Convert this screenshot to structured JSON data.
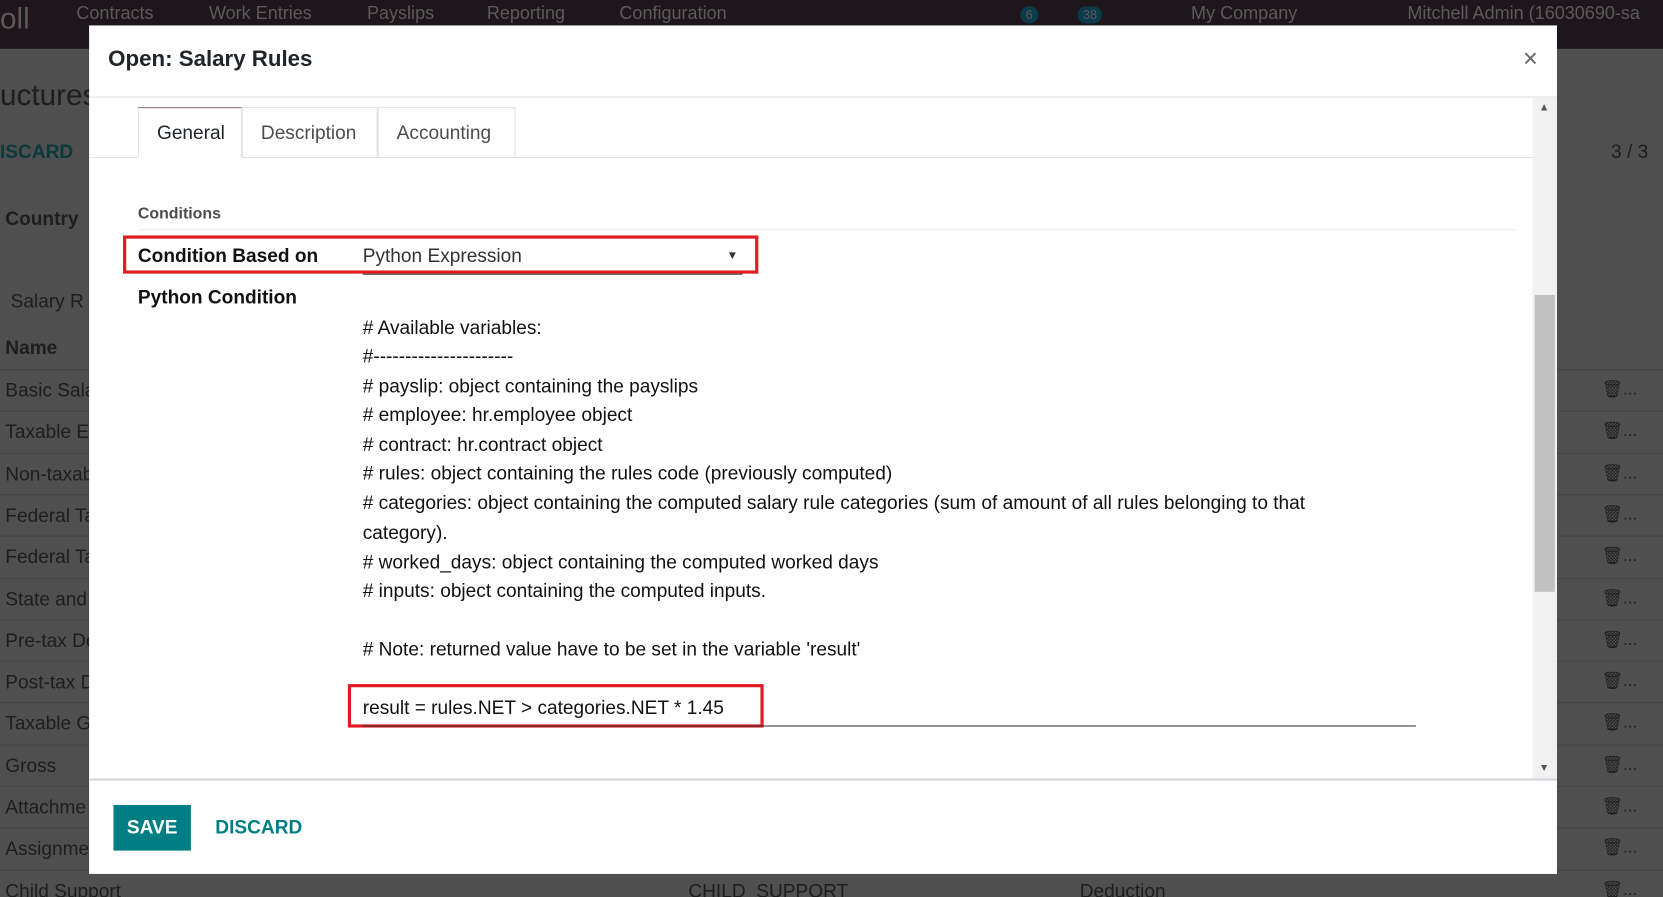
{
  "background": {
    "navbar": {
      "app": "oll",
      "menu": [
        "Contracts",
        "Work Entries",
        "Payslips",
        "Reporting",
        "Configuration"
      ],
      "badges": [
        "6",
        "38"
      ],
      "company": "My Company",
      "user": "Mitchell Admin (16030690-sa"
    },
    "breadcrumb": "uctures",
    "discard": "ISCARD",
    "pager": "3 / 3",
    "country_label": "Country",
    "tab": "Salary R",
    "column_name": "Name",
    "rows": [
      "Basic Sala",
      "Taxable E",
      "Non-taxab",
      "Federal Ta",
      "Federal Ta",
      "State and",
      "Pre-tax De",
      "Post-tax D",
      "Taxable G",
      "Gross",
      "Attachme",
      "Assignme",
      "Child Support"
    ],
    "last_row": {
      "code": "CHILD_SUPPORT",
      "category": "Deduction"
    },
    "trash_label": "..."
  },
  "modal": {
    "title": "Open: Salary Rules",
    "close": "×",
    "tabs": [
      "General",
      "Description",
      "Accounting"
    ],
    "active_tab": "General",
    "section": "Conditions",
    "condition_label": "Condition Based on",
    "condition_value": "Python Expression",
    "python_label": "Python Condition",
    "code_lines": [
      "# Available variables:",
      "#----------------------",
      "# payslip: object containing the payslips",
      "# employee: hr.employee object",
      "# contract: hr.contract object",
      "# rules: object containing the rules code (previously computed)",
      "# categories: object containing the computed salary rule categories (sum of amount of all rules belonging to that",
      "category).",
      "# worked_days: object containing the computed worked days",
      "# inputs: object containing the computed inputs.",
      "",
      "# Note: returned value have to be set in the variable 'result'"
    ],
    "expression": "result = rules.NET > categories.NET * 1.45",
    "save": "SAVE",
    "discard": "DISCARD"
  },
  "colors": {
    "primary": "#017e84",
    "highlight": "#e21b23",
    "navbar": "#6b4c62"
  }
}
